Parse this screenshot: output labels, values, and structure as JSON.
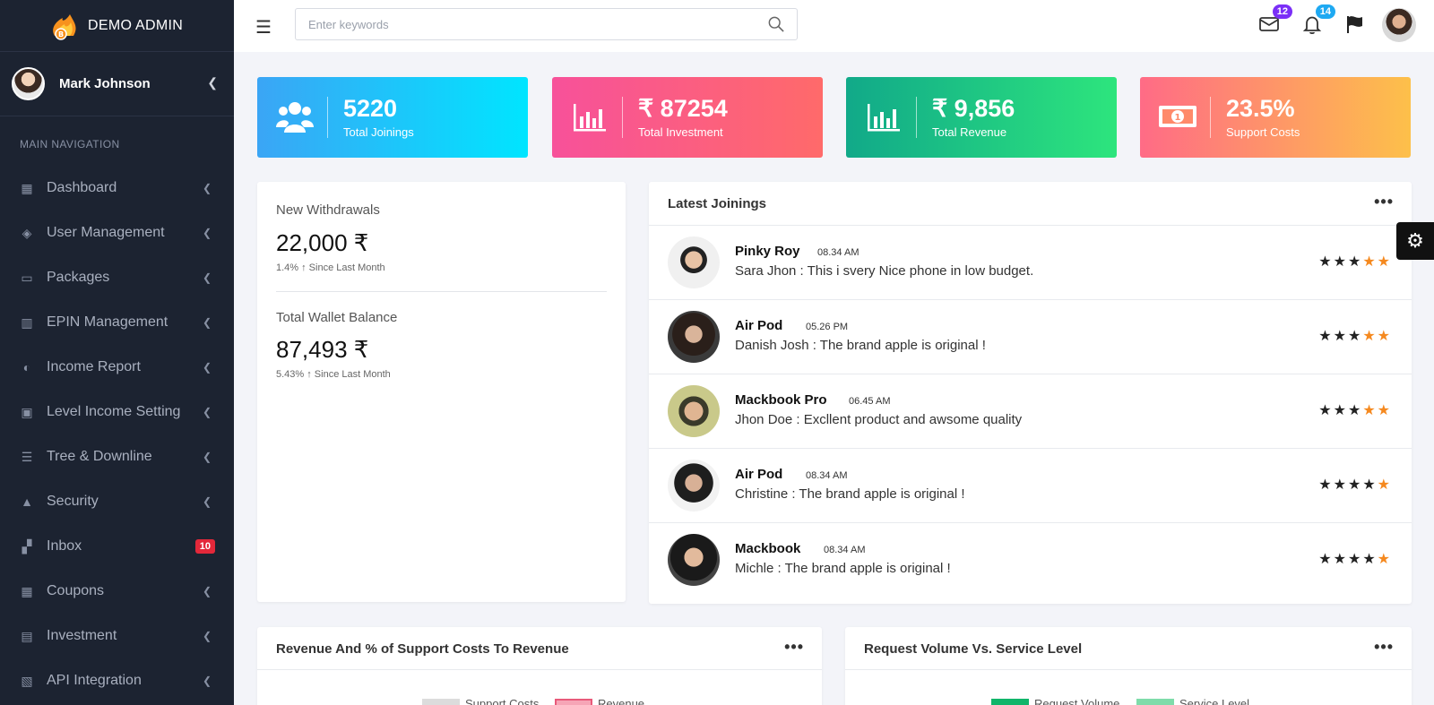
{
  "brand": {
    "title": "DEMO ADMIN"
  },
  "user": {
    "name": "Mark Johnson"
  },
  "nav": {
    "section_title": "MAIN NAVIGATION",
    "items": [
      {
        "label": "Dashboard",
        "icon": "dashboard-icon"
      },
      {
        "label": "User Management",
        "icon": "layers-icon"
      },
      {
        "label": "Packages",
        "icon": "briefcase-icon"
      },
      {
        "label": "EPIN Management",
        "icon": "bar-chart-icon"
      },
      {
        "label": "Income Report",
        "icon": "contrast-icon"
      },
      {
        "label": "Level Income Setting",
        "icon": "calendar-check-icon"
      },
      {
        "label": "Tree & Downline",
        "icon": "list-icon"
      },
      {
        "label": "Security",
        "icon": "lock-icon"
      },
      {
        "label": "Inbox",
        "icon": "inbox-icon",
        "badge": "10"
      },
      {
        "label": "Coupons",
        "icon": "grid-icon"
      },
      {
        "label": "Investment",
        "icon": "map-icon"
      },
      {
        "label": "API Integration",
        "icon": "images-icon"
      }
    ]
  },
  "topbar": {
    "search_placeholder": "Enter keywords",
    "mail_count": "12",
    "notif_count": "14"
  },
  "stats": [
    {
      "value": "5220",
      "label": "Total Joinings"
    },
    {
      "value": "₹ 87254",
      "label": "Total Investment"
    },
    {
      "value": "₹ 9,856",
      "label": "Total Revenue"
    },
    {
      "value": "23.5%",
      "label": "Support Costs"
    }
  ],
  "withdrawals": {
    "title": "New Withdrawals",
    "value": "22,000 ₹",
    "sub": "1.4% ↑ Since Last Month"
  },
  "wallet": {
    "title": "Total Wallet Balance",
    "value": "87,493 ₹",
    "sub": "5.43% ↑ Since Last Month"
  },
  "joinings": {
    "title": "Latest Joinings",
    "rows": [
      {
        "name": "Pinky Roy",
        "time": "08.34 AM",
        "message": "Sara Jhon : This i svery Nice phone in low budget.",
        "rating": 5,
        "dark_stars": 3
      },
      {
        "name": "Air Pod",
        "time": "05.26 PM",
        "message": "Danish Josh : The brand apple is original !",
        "rating": 5,
        "dark_stars": 3
      },
      {
        "name": "Mackbook Pro",
        "time": "06.45 AM",
        "message": "Jhon Doe : Excllent product and awsome quality",
        "rating": 5,
        "dark_stars": 3
      },
      {
        "name": "Air Pod",
        "time": "08.34 AM",
        "message": "Christine : The brand apple is original !",
        "rating": 5,
        "dark_stars": 4
      },
      {
        "name": "Mackbook",
        "time": "08.34 AM",
        "message": "Michle : The brand apple is original !",
        "rating": 5,
        "dark_stars": 4
      }
    ]
  },
  "revenue_card": {
    "title": "Revenue And % of Support Costs To Revenue",
    "legend": [
      "Support Costs",
      "Revenue"
    ]
  },
  "request_card": {
    "title": "Request Volume Vs. Service Level",
    "legend": [
      "Request Volume",
      "Service Level"
    ]
  },
  "colors": {
    "sidebar": "#1c2331",
    "card1": "#00e5ff",
    "card2": "#ff6a88",
    "card3": "#2de57d",
    "card4": "#fdc04a",
    "star_accent": "#f5891f"
  }
}
